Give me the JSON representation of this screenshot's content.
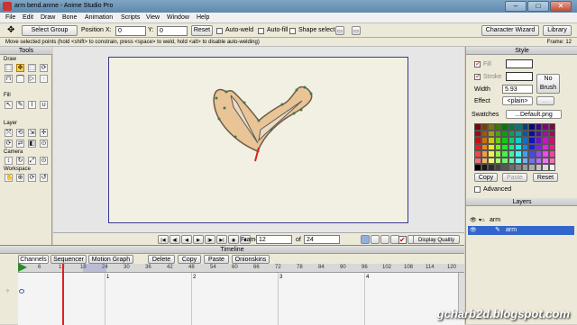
{
  "window": {
    "title": "arm bend.anme - Anime Studio Pro",
    "minimize": "–",
    "maximize": "□",
    "close": "✕"
  },
  "menu": [
    "File",
    "Edit",
    "Draw",
    "Bone",
    "Animation",
    "Scripts",
    "View",
    "Window",
    "Help"
  ],
  "toolbar": {
    "select_group": "Select Group",
    "position_label": "Position",
    "x_label": "X:",
    "x_value": "0",
    "y_label": "Y:",
    "y_value": "0",
    "reset": "Reset",
    "auto_weld": "Auto-weld",
    "auto_fill": "Auto-fill",
    "shape_select": "Shape select",
    "character_wizard": "Character Wizard",
    "library": "Library"
  },
  "hint": "Move selected points (hold <shift> to constrain, press <space> to weld, hold <alt> to disable auto-welding)",
  "frame_indicator": "Frame: 12",
  "tools": {
    "header": "Tools",
    "groups": [
      "Draw",
      "Fill",
      "Layer",
      "Camera",
      "Workspace"
    ],
    "draw_icons": [
      "⬚",
      "✥",
      "⬚",
      "⟳",
      "⊓",
      "⌒",
      "▷",
      "·"
    ],
    "fill_icons": [
      "↖",
      "✎",
      "⌇",
      "∪"
    ],
    "layer_icons": [
      "⤧",
      "⟲",
      "⇲",
      "✛",
      "⟳",
      "⇄",
      "◧",
      "⊙"
    ],
    "camera_icons": [
      "↕",
      "↻",
      "⤢",
      "⊙"
    ],
    "workspace_icons": [
      "✋",
      "⊕",
      "⟳",
      "↺"
    ]
  },
  "canvas_controls": {
    "transport": [
      "|◀",
      "◀|",
      "◀",
      "▶",
      "|▶",
      "▶|",
      "◉",
      "■"
    ],
    "frame_label": "Frame",
    "frame_value": "12",
    "of_label": "of",
    "of_value": "24",
    "display_quality": "Display Quality"
  },
  "timeline": {
    "title": "Timeline",
    "tabs": [
      "Channels",
      "Sequencer",
      "Motion Graph"
    ],
    "buttons": [
      "Delete",
      "Copy",
      "Paste"
    ],
    "onionskins": "Onionskins",
    "ruler_ticks": [
      "0",
      "6",
      "12",
      "18",
      "24",
      "30",
      "36",
      "42",
      "48",
      "54",
      "60",
      "66",
      "72",
      "78",
      "84",
      "90",
      "96",
      "102",
      "108",
      "114",
      "120"
    ],
    "sub_ticks": [
      "1",
      "2",
      "3",
      "4"
    ],
    "current_frame": 12
  },
  "style": {
    "header": "Style",
    "fill_label": "Fill",
    "stroke_label": "Stroke",
    "width_label": "Width",
    "width_value": "5.93",
    "effect_label": "Effect",
    "effect_value": "<plain>",
    "no_brush": "No Brush",
    "swatches_label": "Swatches",
    "swatches_value": "...Default.png",
    "copy": "Copy",
    "paste": "Paste",
    "reset": "Reset",
    "advanced": "Advanced"
  },
  "layers": {
    "header": "Layers",
    "items": [
      {
        "name": "arm"
      },
      {
        "name": "arm"
      }
    ]
  },
  "watermark": "gcharb2d.blogspot.com",
  "colors": {
    "shape_fill": "#e8c496",
    "shape_stroke": "#6d5a45",
    "bone": "#5a5a5a",
    "playhead": "#e02020",
    "accent_layer": "#3366cc"
  }
}
